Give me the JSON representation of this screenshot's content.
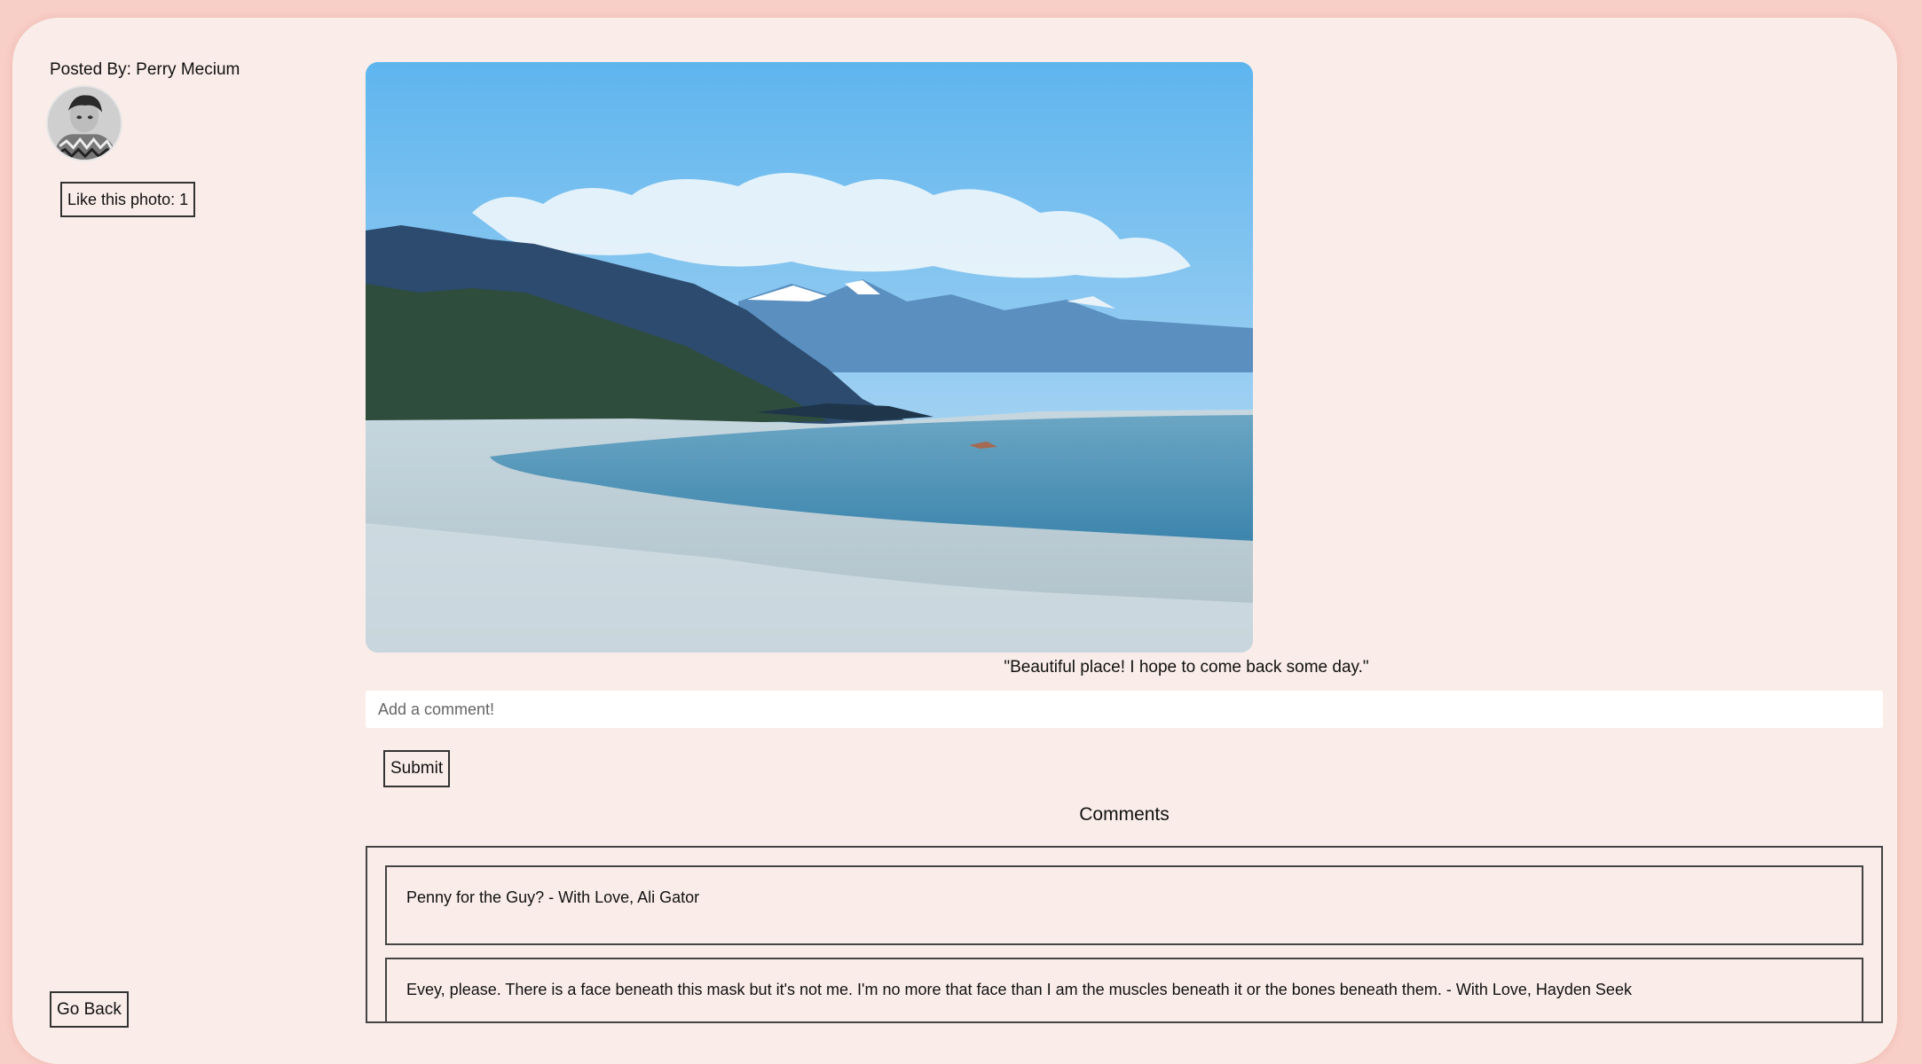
{
  "post": {
    "posted_by": "Posted By: Perry Mecium",
    "like_label": "Like this photo: 1",
    "caption": "\"Beautiful place! I hope to come back some day.\""
  },
  "comment_form": {
    "placeholder": "Add a comment!",
    "submit_label": "Submit"
  },
  "comments": {
    "heading": "Comments",
    "items": [
      {
        "text": "Penny for the Guy? - With Love, Ali Gator"
      },
      {
        "text": "Evey, please. There is a face beneath this mask but it's not me. I'm no more that face than I am the muscles beneath it or the bones beneath them. - With Love, Hayden Seek"
      }
    ]
  },
  "nav": {
    "go_back_label": "Go Back"
  },
  "colors": {
    "page_bg": "#f8cfc7",
    "card_bg": "#faede9"
  }
}
